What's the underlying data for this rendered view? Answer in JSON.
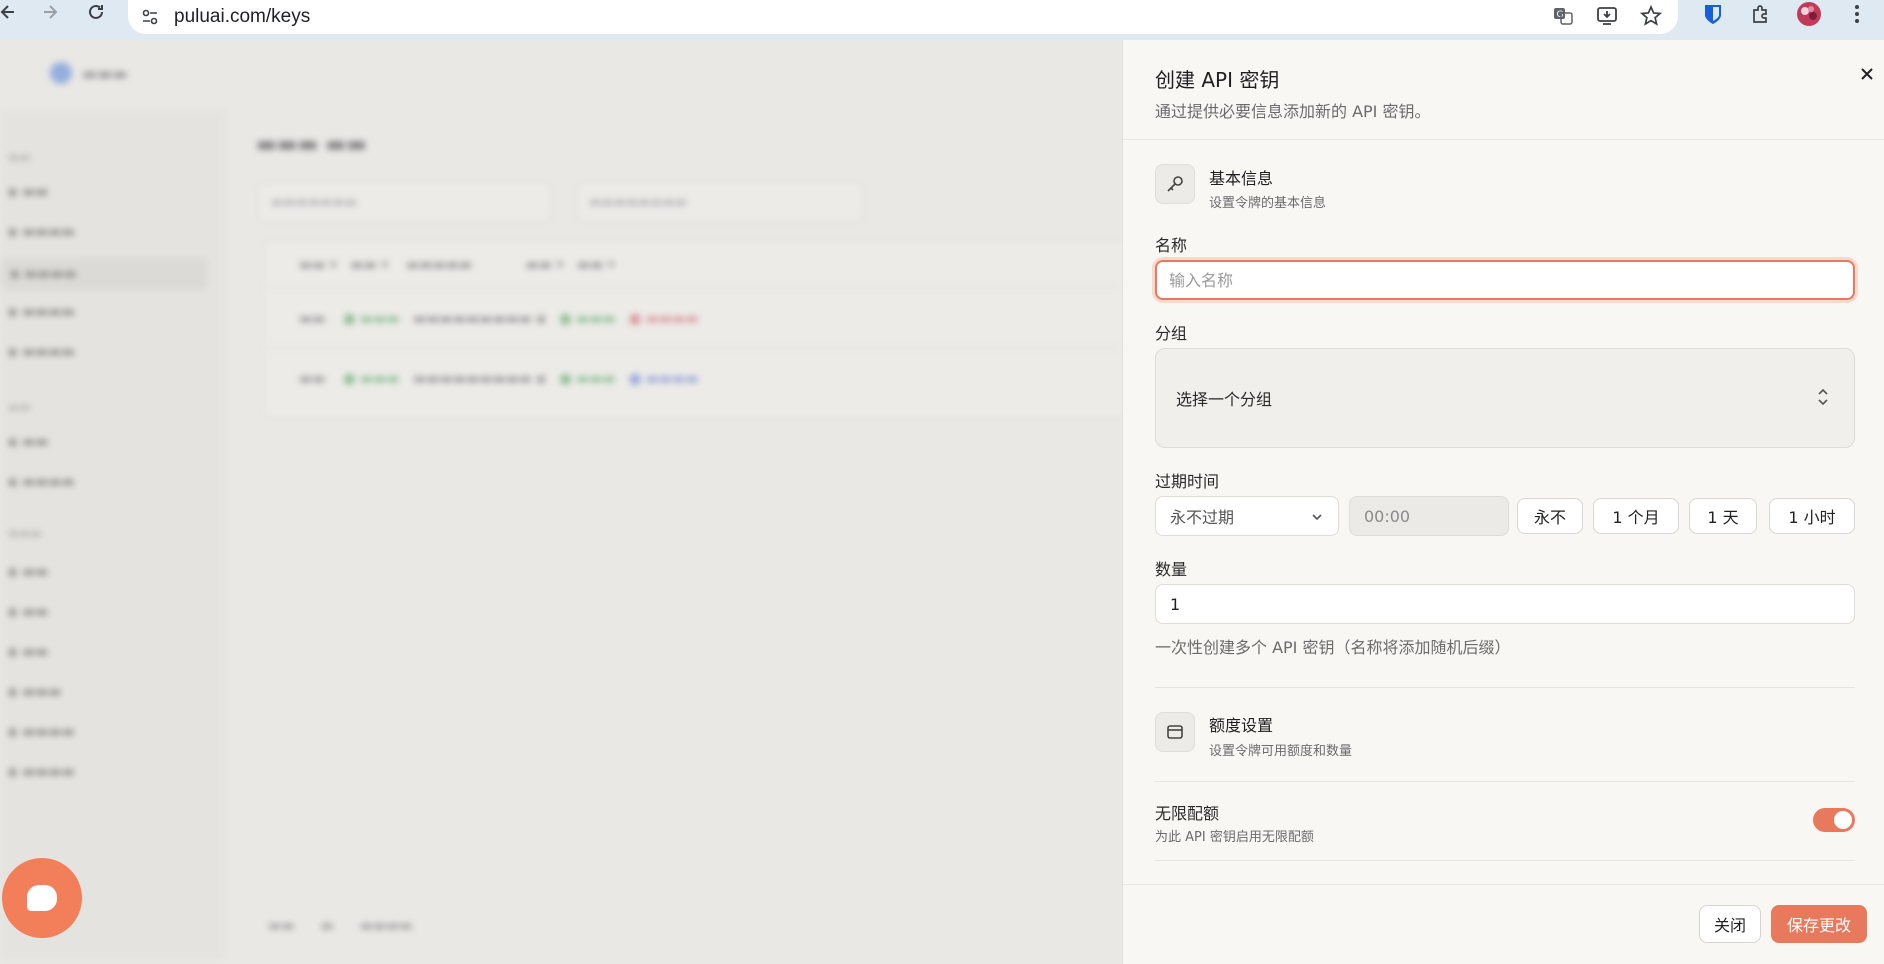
{
  "browser": {
    "url": "puluai.com/keys",
    "icons": [
      "back-icon",
      "forward-icon",
      "reload-icon",
      "site-settings-icon",
      "translate-icon",
      "install-icon",
      "bookmark-star-icon",
      "bitwarden-icon",
      "extensions-icon",
      "profile-avatar",
      "more-vert-icon"
    ]
  },
  "drawer": {
    "title": "创建 API 密钥",
    "description": "通过提供必要信息添加新的 API 密钥。",
    "basic": {
      "title": "基本信息",
      "subtitle": "设置令牌的基本信息",
      "icon": "key-icon"
    },
    "name": {
      "label": "名称",
      "placeholder": "输入名称",
      "value": ""
    },
    "group": {
      "label": "分组",
      "placeholder": "选择一个分组"
    },
    "expire": {
      "label": "过期时间",
      "selected": "永不过期",
      "time": "00:00",
      "quick": [
        "永不",
        "1 个月",
        "1 天",
        "1 小时"
      ]
    },
    "quantity": {
      "label": "数量",
      "value": "1",
      "hint": "一次性创建多个 API 密钥（名称将添加随机后缀）"
    },
    "quota": {
      "title": "额度设置",
      "subtitle": "设置令牌可用额度和数量",
      "icon": "wallet-icon"
    },
    "unlimited": {
      "label": "无限配额",
      "description": "为此 API 密钥启用无限配额",
      "enabled": true
    },
    "footer": {
      "close_label": "关闭",
      "save_label": "保存更改"
    }
  },
  "colors": {
    "accent": "#e8795c",
    "accent_soft": "#f9d9cd",
    "drawer_bg": "#f8f7f4"
  }
}
